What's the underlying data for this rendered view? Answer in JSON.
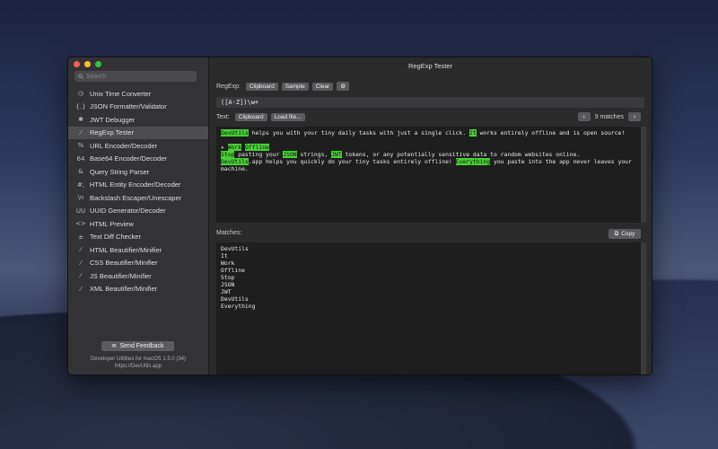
{
  "window": {
    "title": "RegExp Tester"
  },
  "sidebar": {
    "search_placeholder": "Search",
    "items": [
      {
        "label": "Unix Time Converter",
        "icon": "clock-icon",
        "glyph": "◷"
      },
      {
        "label": "JSON Formatter/Validator",
        "icon": "braces-icon",
        "glyph": "{.}"
      },
      {
        "label": "JWT Debugger",
        "icon": "jwt-icon",
        "glyph": "✱"
      },
      {
        "label": "RegExp Tester",
        "icon": "regex-icon",
        "glyph": "⁄"
      },
      {
        "label": "URL Encoder/Decoder",
        "icon": "percent-icon",
        "glyph": "%"
      },
      {
        "label": "Base64 Encoder/Decoder",
        "icon": "base64-icon",
        "glyph": "64"
      },
      {
        "label": "Query String Parser",
        "icon": "ampersand-icon",
        "glyph": "&"
      },
      {
        "label": "HTML Entity Encoder/Decoder",
        "icon": "hash-icon",
        "glyph": "#;"
      },
      {
        "label": "Backslash Escaper/Unescaper",
        "icon": "backslash-icon",
        "glyph": "\\n"
      },
      {
        "label": "UUID Generator/Decoder",
        "icon": "uuid-icon",
        "glyph": "UU"
      },
      {
        "label": "HTML Preview",
        "icon": "code-icon",
        "glyph": "<>"
      },
      {
        "label": "Text Diff Checker",
        "icon": "diff-icon",
        "glyph": "±"
      },
      {
        "label": "HTML Beautifier/Minifier",
        "icon": "wand-icon",
        "glyph": "⁄"
      },
      {
        "label": "CSS Beautifier/Minifier",
        "icon": "wand-icon",
        "glyph": "⁄"
      },
      {
        "label": "JS Beautifier/Minifier",
        "icon": "wand-icon",
        "glyph": "⁄"
      },
      {
        "label": "XML Beautifier/Minifier",
        "icon": "wand-icon",
        "glyph": "⁄"
      }
    ],
    "selected_index": 3,
    "feedback_label": "Send Feedback",
    "footer_line1": "Developer Utilities for macOS 1.5.0 (34)",
    "footer_line2": "https://DevUtils.app"
  },
  "regexp": {
    "label": "RegExp:",
    "clipboard": "Clipboard",
    "sample": "Sample",
    "clear": "Clear",
    "value": "([A-Z])\\w+"
  },
  "text": {
    "label": "Text:",
    "clipboard": "Clipboard",
    "load": "Load file...",
    "match_count": "9 matches"
  },
  "matches": {
    "label": "Matches:",
    "copy": "Copy",
    "list": [
      "DevUtils",
      "It",
      "Work",
      "Offline",
      "Stop",
      "JSON",
      "JWT",
      "DevUtils",
      "Everything"
    ]
  },
  "colors": {
    "highlight": "#48d035",
    "selected_bg": "#4d4d50"
  }
}
